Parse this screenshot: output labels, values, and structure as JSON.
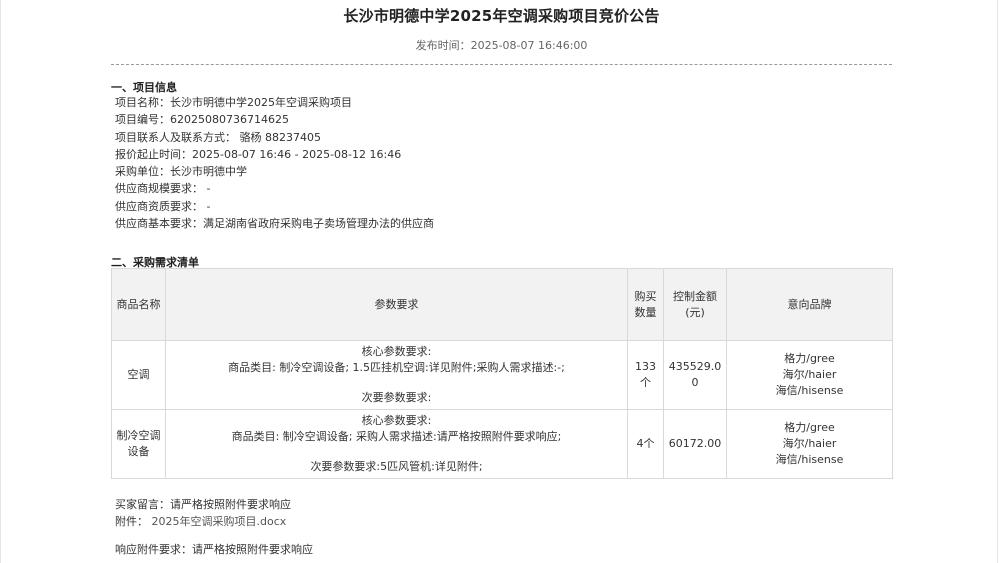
{
  "title": "长沙市明德中学2025年空调采购项目竞价公告",
  "publish_time": "发布时间：2025-08-07 16:46:00",
  "section1": {
    "heading": "一、项目信息",
    "items": [
      "项目名称：长沙市明德中学2025年空调采购项目",
      "项目编号：62025080736714625",
      "项目联系人及联系方式： 骆杨  88237405",
      "报价起止时间：2025-08-07 16:46  -  2025-08-12 16:46",
      "采购单位：长沙市明德中学",
      "供应商规模要求： -",
      "供应商资质要求： -",
      "供应商基本要求：满足湖南省政府采购电子卖场管理办法的供应商"
    ]
  },
  "section2": {
    "heading": "二、采购需求清单",
    "headers": {
      "name": "商品名称",
      "params": "参数要求",
      "qty": "购买数量",
      "amount": "控制金额(元)",
      "brand": "意向品牌"
    },
    "rows": [
      {
        "name": "空调",
        "params": {
          "core_title": "核心参数要求:",
          "core": "商品类目: 制冷空调设备; 1.5匹挂机空调:详见附件;采购人需求描述:-;",
          "secondary": "次要参数要求:"
        },
        "qty": "133个",
        "amount": "435529.00",
        "brands": [
          "格力/gree",
          "海尔/haier",
          "海信/hisense"
        ]
      },
      {
        "name": "制冷空调设备",
        "params": {
          "core_title": "核心参数要求:",
          "core": "商品类目: 制冷空调设备; 采购人需求描述:请严格按照附件要求响应;",
          "secondary": "次要参数要求:5匹风管机:详见附件;"
        },
        "qty": "4个",
        "amount": "60172.00",
        "brands": [
          "格力/gree",
          "海尔/haier",
          "海信/hisense"
        ]
      }
    ]
  },
  "footer": {
    "buyer_note": "买家留言：请严格按照附件要求响应",
    "attachment_label": "附件：",
    "attachment_file": "2025年空调采购项目.docx",
    "response_req": "响应附件要求：请严格按照附件要求响应"
  }
}
